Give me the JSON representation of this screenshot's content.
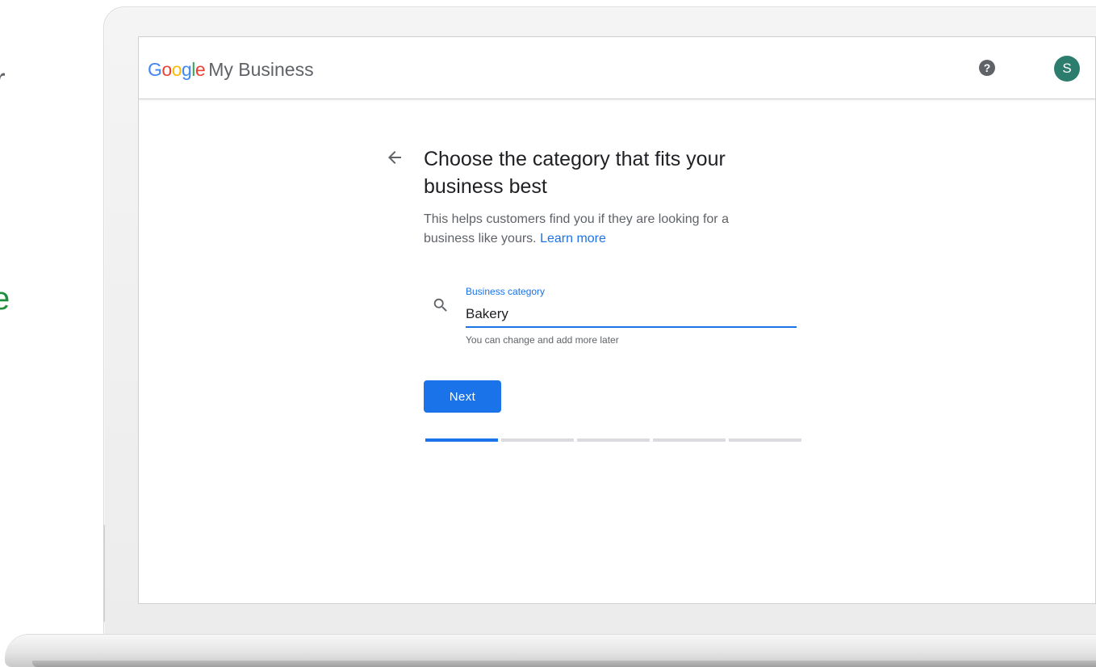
{
  "app": {
    "logo_parts": [
      {
        "text": "G",
        "color": "#4285F4"
      },
      {
        "text": "o",
        "color": "#EA4335"
      },
      {
        "text": "o",
        "color": "#FBBC05"
      },
      {
        "text": "g",
        "color": "#4285F4"
      },
      {
        "text": "l",
        "color": "#34A853"
      },
      {
        "text": "e",
        "color": "#EA4335"
      }
    ],
    "product_name": "My Business",
    "help_symbol": "?",
    "avatar_initial": "S",
    "avatar_color": "#2d7d6f"
  },
  "edge_text": {
    "top_glyph": "r",
    "mid_glyph": "e",
    "mid_color": "#1e8e3e"
  },
  "page": {
    "back_icon": "arrow-back-icon",
    "title": "Choose the category that fits your business best",
    "subtitle": "This helps customers find you if they are looking for a business like yours.",
    "learn_more": "Learn more"
  },
  "category_field": {
    "icon": "search-icon",
    "label": "Business category",
    "value": "Bakery",
    "hint": "You can change and add more later"
  },
  "actions": {
    "next_label": "Next",
    "primary_color": "#1a73e8"
  },
  "progress": {
    "total_steps": 5,
    "current_step": 1
  }
}
